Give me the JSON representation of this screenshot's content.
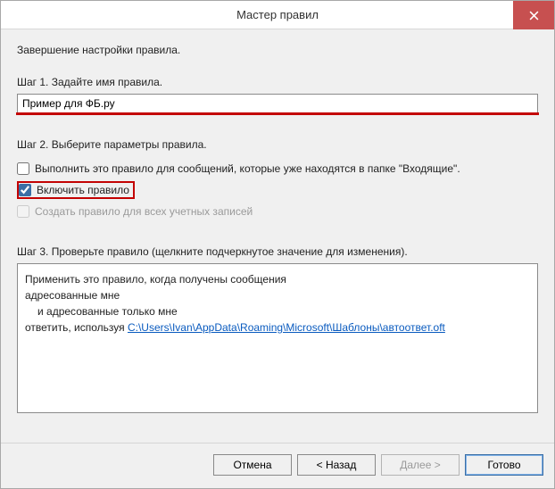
{
  "window": {
    "title": "Мастер правил"
  },
  "intro": "Завершение настройки правила.",
  "step1": {
    "label": "Шаг 1. Задайте имя правила.",
    "value": "Пример для ФБ.ру"
  },
  "step2": {
    "label": "Шаг 2. Выберите параметры правила.",
    "options": {
      "run_now": {
        "label": "Выполнить это правило для сообщений, которые уже находятся в папке \"Входящие\".",
        "checked": false
      },
      "enable": {
        "label": "Включить правило",
        "checked": true
      },
      "all_acc": {
        "label": "Создать правило для всех учетных записей",
        "checked": false
      }
    }
  },
  "step3": {
    "label": "Шаг 3. Проверьте правило (щелкните подчеркнутое значение для изменения).",
    "lines": {
      "l1": "Применить это правило, когда получены сообщения",
      "l2": "адресованные мне",
      "l3": "и адресованные только мне",
      "l4_prefix": "ответить, используя ",
      "l4_link": "C:\\Users\\Ivan\\AppData\\Roaming\\Microsoft\\Шаблоны\\автоответ.oft"
    }
  },
  "buttons": {
    "cancel": "Отмена",
    "back": "< Назад",
    "next": "Далее >",
    "finish": "Готово"
  }
}
